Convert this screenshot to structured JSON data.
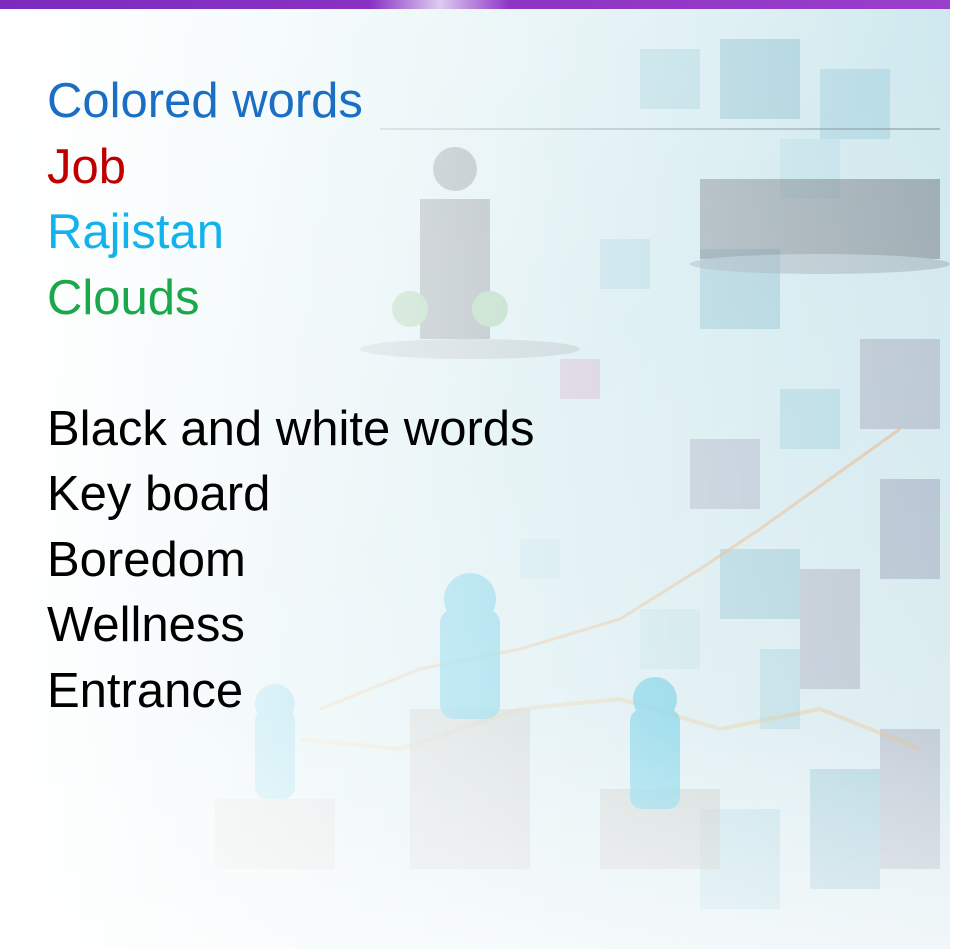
{
  "colored_section": {
    "heading": "Colored words",
    "words": [
      {
        "text": "Job",
        "color": "#c00000"
      },
      {
        "text": "Rajistan",
        "color": "#14b2ec"
      },
      {
        "text": "Clouds",
        "color": "#1aa84a"
      }
    ],
    "heading_color": "#1a6fc4"
  },
  "bw_section": {
    "heading": "Black and white words",
    "words": [
      "Key board",
      "Boredom",
      "Wellness",
      "Entrance"
    ]
  },
  "theme": {
    "accent_bar": "#8f36c6"
  }
}
